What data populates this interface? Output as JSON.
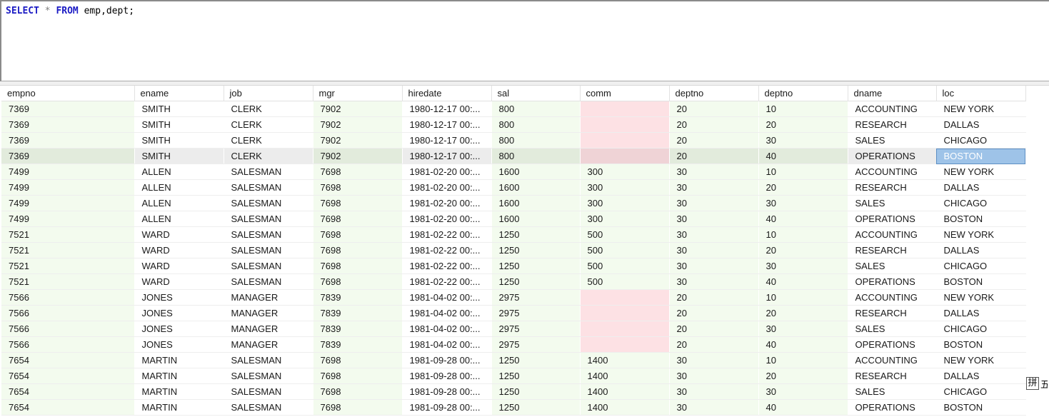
{
  "editor": {
    "query": {
      "select_kw": "SELECT",
      "star": "*",
      "from_kw": "FROM",
      "tables": "emp,dept",
      "terminator": ";"
    }
  },
  "grid": {
    "columns": [
      "empno",
      "ename",
      "job",
      "mgr",
      "hiredate",
      "sal",
      "comm",
      "deptno",
      "deptno",
      "dname",
      "loc"
    ],
    "numeric_columns": [
      0,
      3,
      5,
      6,
      7,
      8
    ],
    "selected_row": 3,
    "focused_column": 10,
    "rows": [
      [
        "7369",
        "SMITH",
        "CLERK",
        "7902",
        "1980-12-17 00:...",
        "800",
        "",
        "20",
        "10",
        "ACCOUNTING",
        "NEW YORK"
      ],
      [
        "7369",
        "SMITH",
        "CLERK",
        "7902",
        "1980-12-17 00:...",
        "800",
        "",
        "20",
        "20",
        "RESEARCH",
        "DALLAS"
      ],
      [
        "7369",
        "SMITH",
        "CLERK",
        "7902",
        "1980-12-17 00:...",
        "800",
        "",
        "20",
        "30",
        "SALES",
        "CHICAGO"
      ],
      [
        "7369",
        "SMITH",
        "CLERK",
        "7902",
        "1980-12-17 00:...",
        "800",
        "",
        "20",
        "40",
        "OPERATIONS",
        "BOSTON"
      ],
      [
        "7499",
        "ALLEN",
        "SALESMAN",
        "7698",
        "1981-02-20 00:...",
        "1600",
        "300",
        "30",
        "10",
        "ACCOUNTING",
        "NEW YORK"
      ],
      [
        "7499",
        "ALLEN",
        "SALESMAN",
        "7698",
        "1981-02-20 00:...",
        "1600",
        "300",
        "30",
        "20",
        "RESEARCH",
        "DALLAS"
      ],
      [
        "7499",
        "ALLEN",
        "SALESMAN",
        "7698",
        "1981-02-20 00:...",
        "1600",
        "300",
        "30",
        "30",
        "SALES",
        "CHICAGO"
      ],
      [
        "7499",
        "ALLEN",
        "SALESMAN",
        "7698",
        "1981-02-20 00:...",
        "1600",
        "300",
        "30",
        "40",
        "OPERATIONS",
        "BOSTON"
      ],
      [
        "7521",
        "WARD",
        "SALESMAN",
        "7698",
        "1981-02-22 00:...",
        "1250",
        "500",
        "30",
        "10",
        "ACCOUNTING",
        "NEW YORK"
      ],
      [
        "7521",
        "WARD",
        "SALESMAN",
        "7698",
        "1981-02-22 00:...",
        "1250",
        "500",
        "30",
        "20",
        "RESEARCH",
        "DALLAS"
      ],
      [
        "7521",
        "WARD",
        "SALESMAN",
        "7698",
        "1981-02-22 00:...",
        "1250",
        "500",
        "30",
        "30",
        "SALES",
        "CHICAGO"
      ],
      [
        "7521",
        "WARD",
        "SALESMAN",
        "7698",
        "1981-02-22 00:...",
        "1250",
        "500",
        "30",
        "40",
        "OPERATIONS",
        "BOSTON"
      ],
      [
        "7566",
        "JONES",
        "MANAGER",
        "7839",
        "1981-04-02 00:...",
        "2975",
        "",
        "20",
        "10",
        "ACCOUNTING",
        "NEW YORK"
      ],
      [
        "7566",
        "JONES",
        "MANAGER",
        "7839",
        "1981-04-02 00:...",
        "2975",
        "",
        "20",
        "20",
        "RESEARCH",
        "DALLAS"
      ],
      [
        "7566",
        "JONES",
        "MANAGER",
        "7839",
        "1981-04-02 00:...",
        "2975",
        "",
        "20",
        "30",
        "SALES",
        "CHICAGO"
      ],
      [
        "7566",
        "JONES",
        "MANAGER",
        "7839",
        "1981-04-02 00:...",
        "2975",
        "",
        "20",
        "40",
        "OPERATIONS",
        "BOSTON"
      ],
      [
        "7654",
        "MARTIN",
        "SALESMAN",
        "7698",
        "1981-09-28 00:...",
        "1250",
        "1400",
        "30",
        "10",
        "ACCOUNTING",
        "NEW YORK"
      ],
      [
        "7654",
        "MARTIN",
        "SALESMAN",
        "7698",
        "1981-09-28 00:...",
        "1250",
        "1400",
        "30",
        "20",
        "RESEARCH",
        "DALLAS"
      ],
      [
        "7654",
        "MARTIN",
        "SALESMAN",
        "7698",
        "1981-09-28 00:...",
        "1250",
        "1400",
        "30",
        "30",
        "SALES",
        "CHICAGO"
      ],
      [
        "7654",
        "MARTIN",
        "SALESMAN",
        "7698",
        "1981-09-28 00:...",
        "1250",
        "1400",
        "30",
        "40",
        "OPERATIONS",
        "BOSTON"
      ]
    ]
  },
  "ime": {
    "mode_glyph": "拼",
    "extra_glyph": "五"
  },
  "colors": {
    "keyword": "#1b1bc4",
    "numeric_cell_bg": "#f3fbee",
    "null_cell_bg": "#fde1e4",
    "selected_row_bg": "#ececec",
    "focused_cell_bg": "#9ec3e8"
  }
}
